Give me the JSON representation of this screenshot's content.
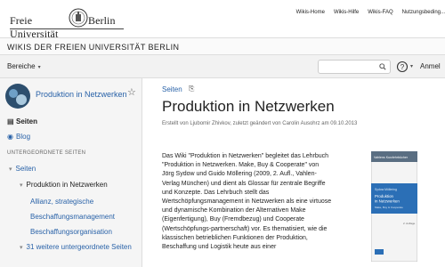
{
  "header": {
    "logo_left": "Freie Universität",
    "logo_right": "Berlin",
    "links": [
      "Wikis-Home",
      "Wikis-Hilfe",
      "Wikis-FAQ",
      "Nutzungsbeding..."
    ]
  },
  "wiki_title": "WIKIS DER FREIEN UNIVERSITÄT BERLIN",
  "toolbar": {
    "areas_label": "Bereiche",
    "search_placeholder": "",
    "login_label": "Anmel"
  },
  "sidebar": {
    "space_name": "Produktion in Netzwerken",
    "nav": [
      {
        "label": "Seiten",
        "icon": "pages-icon"
      },
      {
        "label": "Blog",
        "icon": "rss-icon"
      }
    ],
    "section_heading": "UNTERGEORDNETE SEITEN",
    "tree": [
      {
        "label": "Seiten"
      },
      {
        "label": "Produktion in Netzwerken"
      },
      {
        "label": "Allianz, strategische"
      },
      {
        "label": "Beschaffungsmanagement"
      },
      {
        "label": "Beschaffungsorganisation"
      },
      {
        "label": "31 weitere untergeordnete Seiten"
      }
    ]
  },
  "main": {
    "breadcrumb": "Seiten",
    "title": "Produktion in Netzwerken",
    "meta": "Erstellt von Ljubomir Zhivkov, zuletzt geändert von Carolin Ausohrz am 09.10.2013",
    "body_lines": [
      "Das Wiki \"Produktion in Netzwerken\" begleitet das Lehrbuch",
      "\"Produktion in Netzwerken. Make, Buy & Cooperate\" von",
      "Jörg Sydow und Guido Möllering (2009, 2. Aufl., Vahlen-",
      "Verlag München)  und dient als Glossar für zentrale Begriffe",
      "und Konzepte. Das Lehrbuch stellt das",
      "Wertschöpfungsmanagement in Netzwerken als eine virtuose",
      "und dynamische Kombination der Alternativen Make",
      "(Eigenfertigung), Buy (Fremdbezug) und Cooperate",
      "(Wertschöpfungs-partnerschaft) vor. Es thematisiert, wie die",
      "klassischen betrieblichen Funktionen der Produktion,",
      "Beschaffung und Logistik heute aus einer"
    ],
    "book": {
      "publisher": "Vahlens Kurzlehrbücher",
      "authors": "Sydow Möllering",
      "title_line1": "Produktion",
      "title_line2": "in Netzwerken",
      "subtitle": "Make, Buy & Cooperate",
      "edition": "2. Auflage"
    }
  },
  "colors": {
    "link": "#2962a8",
    "book_blue": "#2b6fb6"
  }
}
